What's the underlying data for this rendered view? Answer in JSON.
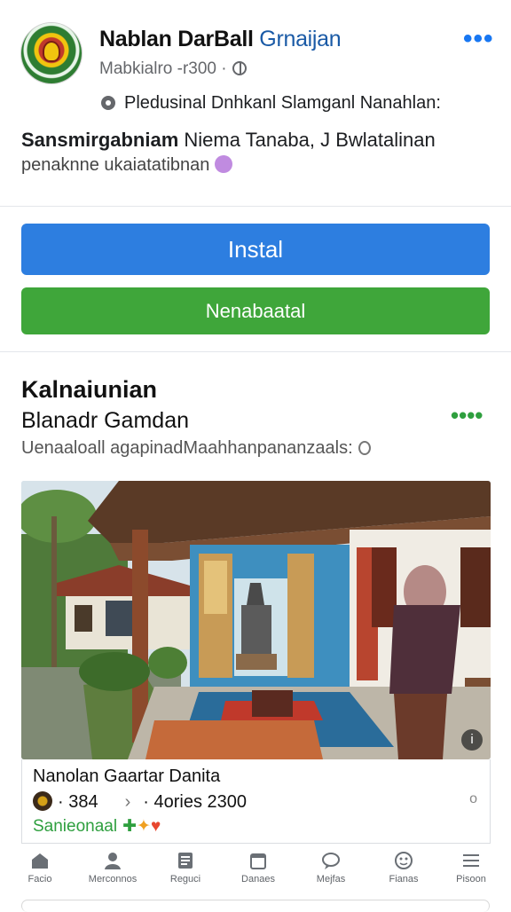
{
  "header": {
    "page_name": "Nablan DarBall",
    "page_name_accent": "Grnaijan",
    "meta": "Mabkialro -r300 ·",
    "location": "Pledusinal Dnhkanl Slamganl Nanahlan:",
    "description_bold": "Sansmirgabniam",
    "description_rest": " Niema Tanaba, J Bwlatalinan",
    "description_line2": "penaknne ukaiatatibnan",
    "more_icon": "more-dots-icon",
    "accent_color": "#1877f2"
  },
  "actions": {
    "primary_label": "Instal",
    "secondary_label": "Nenabaatal",
    "primary_color": "#2d7ee0",
    "secondary_color": "#3fa63a"
  },
  "section": {
    "title": "Kalnaiunian",
    "subtitle": "Blanadr Gamdan",
    "caption": "Uenaaloall agapinadMaahhanpananzaals:",
    "dots_color": "#2e9f3e"
  },
  "card": {
    "title": "Nanolan Gaartar Danita",
    "stats_left": "· 384",
    "stats_chevron": "›",
    "stats_right": "· 4ories 2300",
    "more": "o",
    "tag": "Sanieonaal",
    "photo_info": "i"
  },
  "nav": {
    "items": [
      {
        "label": "Facio",
        "icon": "home-icon"
      },
      {
        "label": "Merconnos",
        "icon": "profile-icon"
      },
      {
        "label": "Reguci",
        "icon": "document-icon"
      },
      {
        "label": "Danaes",
        "icon": "calendar-icon"
      },
      {
        "label": "Mejfas",
        "icon": "chat-icon"
      },
      {
        "label": "Fianas",
        "icon": "face-icon"
      },
      {
        "label": "Pisoon",
        "icon": "menu-icon"
      }
    ]
  }
}
